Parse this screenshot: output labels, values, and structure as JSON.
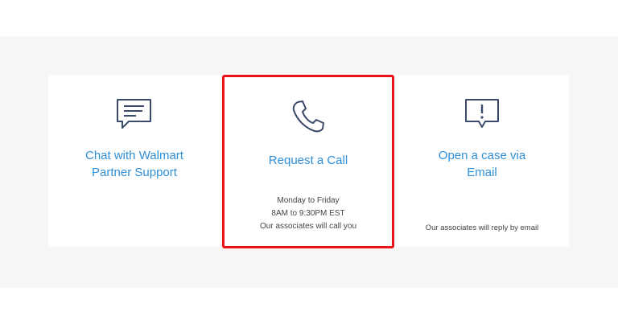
{
  "options": {
    "chat": {
      "icon": "chat-bubble-icon",
      "title_line1": "Chat with Walmart",
      "title_line2": "Partner Support"
    },
    "call": {
      "icon": "phone-icon",
      "title": "Request a Call",
      "hours_days": "Monday to Friday",
      "hours_time": "8AM to 9:30PM EST",
      "note": "Our associates will call you",
      "highlighted": true
    },
    "email": {
      "icon": "alert-bubble-icon",
      "title_line1": "Open a case via",
      "title_line2": "Email",
      "note": "Our associates will reply by email"
    }
  },
  "colors": {
    "link": "#2f8fd8",
    "icon": "#3a4a6b",
    "highlight": "#e8141a",
    "band": "#f6f6f6"
  }
}
